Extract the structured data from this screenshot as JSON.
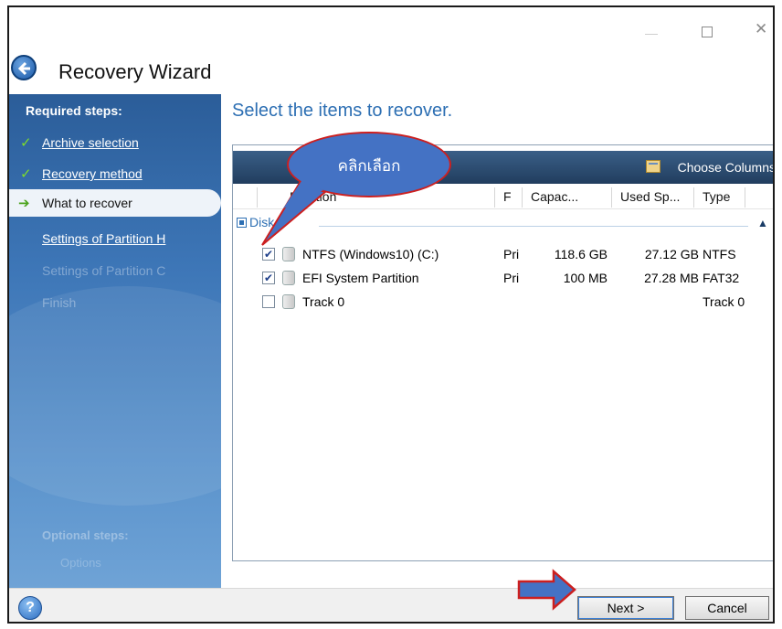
{
  "window": {
    "title": "Recovery Wizard"
  },
  "nav": {
    "required_heading": "Required steps:",
    "items": [
      {
        "label": "Archive selection",
        "state": "done"
      },
      {
        "label": "Recovery method",
        "state": "done"
      },
      {
        "label": "What to recover",
        "state": "current"
      },
      {
        "label": "Settings of Partition H",
        "state": "available"
      },
      {
        "label": "Settings of Partition C",
        "state": "disabled"
      },
      {
        "label": "Finish",
        "state": "disabled"
      }
    ],
    "optional_heading": "Optional steps:",
    "optional_item": "Options"
  },
  "main": {
    "heading": "Select the items to recover.",
    "toolbar": {
      "choose_columns": "Choose Columns"
    },
    "columns": [
      "Partition",
      "F",
      "Capac...",
      "Used Sp...",
      "Type"
    ],
    "group_label": "Disk 1",
    "rows": [
      {
        "checked": true,
        "name": "NTFS (Windows10) (C:)",
        "flag": "Pri",
        "capacity": "118.6 GB",
        "used": "27.12 GB",
        "type": "NTFS"
      },
      {
        "checked": true,
        "name": "EFI System Partition",
        "flag": "Pri",
        "capacity": "100 MB",
        "used": "27.28 MB",
        "type": "FAT32"
      },
      {
        "checked": false,
        "name": "Track 0",
        "flag": "",
        "capacity": "",
        "used": "",
        "type": "Track 0"
      }
    ]
  },
  "callout": {
    "text": "คลิกเลือก"
  },
  "buttons": {
    "help": "?",
    "next": "Next >",
    "cancel": "Cancel"
  },
  "colors": {
    "accent": "#2d6fb3",
    "sidebar": "#3d76b7",
    "callout": "#4472c4",
    "callout_border": "#cc1f1f"
  }
}
